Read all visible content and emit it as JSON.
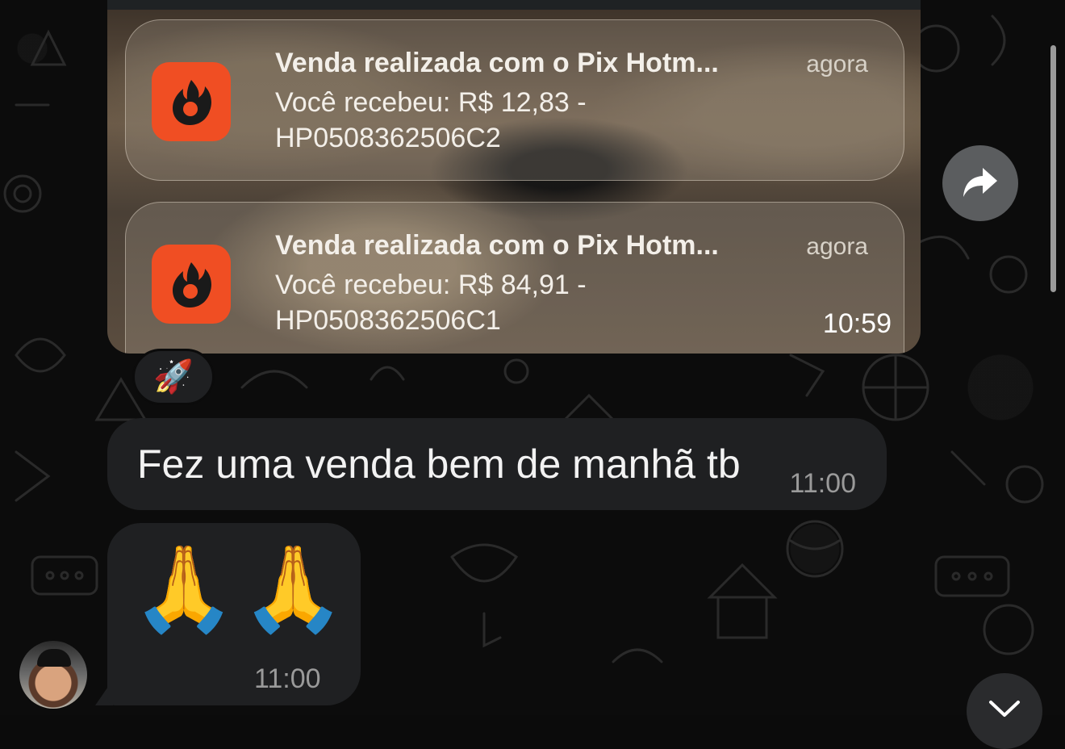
{
  "notifications": [
    {
      "title": "Venda realizada com o Pix Hotm...",
      "time": "agora",
      "body_line1": "Você recebeu: R$ 12,83 -",
      "body_line2": "HP0508362506C2"
    },
    {
      "title": "Venda realizada com o Pix Hotm...",
      "time": "agora",
      "body_line1": "Você recebeu: R$ 84,91 -",
      "body_line2": "HP0508362506C1"
    }
  ],
  "image_message": {
    "timestamp": "10:59"
  },
  "reaction": {
    "emoji": "🚀"
  },
  "messages": [
    {
      "text": "Fez uma venda bem de manhã tb",
      "time": "11:00"
    },
    {
      "emojis": "🙏🙏",
      "time": "11:00"
    }
  ],
  "colors": {
    "app_icon": "#f04e23",
    "bubble": "#1f2022",
    "background": "#0b0b0b"
  },
  "icons": {
    "forward": "forward-arrow-icon",
    "scroll_down": "chevron-down-icon",
    "app": "hotmart-flame-icon"
  }
}
